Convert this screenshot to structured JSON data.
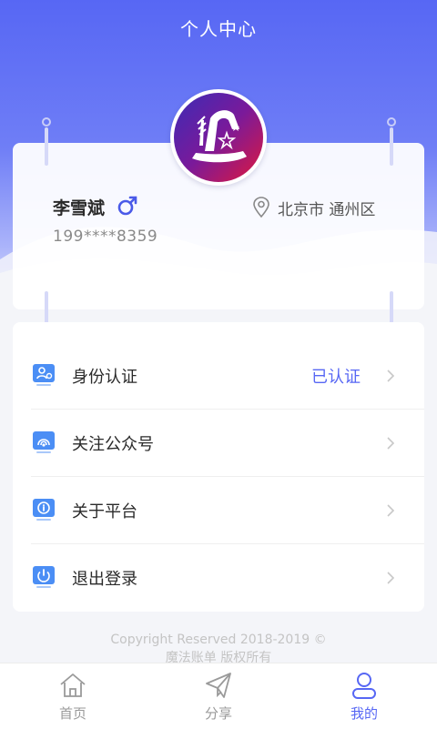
{
  "header": {
    "title": "个人中心"
  },
  "profile": {
    "name": "李雪斌",
    "gender": "male",
    "phone": "199****8359",
    "location": "北京市 通州区"
  },
  "menu": [
    {
      "label": "身份认证",
      "status": "已认证",
      "icon": "id-verify-icon"
    },
    {
      "label": "关注公众号",
      "status": "",
      "icon": "wechat-follow-icon"
    },
    {
      "label": "关于平台",
      "status": "",
      "icon": "about-icon"
    },
    {
      "label": "退出登录",
      "status": "",
      "icon": "power-icon"
    }
  ],
  "footer": {
    "copyright_line1": "Copyright Reserved 2018-2019 ©",
    "copyright_line2": "魔法账单   版权所有"
  },
  "tabbar": [
    {
      "label": "首页",
      "icon": "home-icon",
      "active": false
    },
    {
      "label": "分享",
      "icon": "share-icon",
      "active": false
    },
    {
      "label": "我的",
      "icon": "user-icon",
      "active": true
    }
  ],
  "colors": {
    "accent": "#5767f4",
    "text": "#2a2a2a",
    "muted": "#8a8a8a"
  }
}
